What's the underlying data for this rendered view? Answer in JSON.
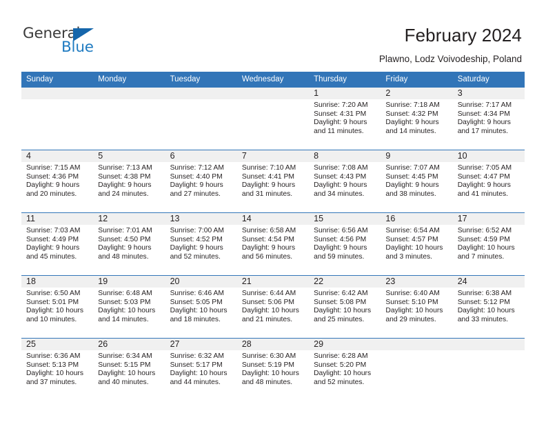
{
  "brand": {
    "name_part1": "General",
    "name_part2": "Blue",
    "accent_color": "#1f7bc1",
    "triangle_color": "#1566ab"
  },
  "header": {
    "title": "February 2024",
    "subtitle": "Plawno, Lodz Voivodeship, Poland"
  },
  "calendar": {
    "header_background": "#3275b8",
    "daynum_background": "#f0f0f0",
    "weekday_headers": [
      "Sunday",
      "Monday",
      "Tuesday",
      "Wednesday",
      "Thursday",
      "Friday",
      "Saturday"
    ],
    "weeks": [
      [
        {
          "day": "",
          "sunrise": "",
          "sunset": "",
          "daylight_line1": "",
          "daylight_line2": ""
        },
        {
          "day": "",
          "sunrise": "",
          "sunset": "",
          "daylight_line1": "",
          "daylight_line2": ""
        },
        {
          "day": "",
          "sunrise": "",
          "sunset": "",
          "daylight_line1": "",
          "daylight_line2": ""
        },
        {
          "day": "",
          "sunrise": "",
          "sunset": "",
          "daylight_line1": "",
          "daylight_line2": ""
        },
        {
          "day": "1",
          "sunrise": "Sunrise: 7:20 AM",
          "sunset": "Sunset: 4:31 PM",
          "daylight_line1": "Daylight: 9 hours",
          "daylight_line2": "and 11 minutes."
        },
        {
          "day": "2",
          "sunrise": "Sunrise: 7:18 AM",
          "sunset": "Sunset: 4:32 PM",
          "daylight_line1": "Daylight: 9 hours",
          "daylight_line2": "and 14 minutes."
        },
        {
          "day": "3",
          "sunrise": "Sunrise: 7:17 AM",
          "sunset": "Sunset: 4:34 PM",
          "daylight_line1": "Daylight: 9 hours",
          "daylight_line2": "and 17 minutes."
        }
      ],
      [
        {
          "day": "4",
          "sunrise": "Sunrise: 7:15 AM",
          "sunset": "Sunset: 4:36 PM",
          "daylight_line1": "Daylight: 9 hours",
          "daylight_line2": "and 20 minutes."
        },
        {
          "day": "5",
          "sunrise": "Sunrise: 7:13 AM",
          "sunset": "Sunset: 4:38 PM",
          "daylight_line1": "Daylight: 9 hours",
          "daylight_line2": "and 24 minutes."
        },
        {
          "day": "6",
          "sunrise": "Sunrise: 7:12 AM",
          "sunset": "Sunset: 4:40 PM",
          "daylight_line1": "Daylight: 9 hours",
          "daylight_line2": "and 27 minutes."
        },
        {
          "day": "7",
          "sunrise": "Sunrise: 7:10 AM",
          "sunset": "Sunset: 4:41 PM",
          "daylight_line1": "Daylight: 9 hours",
          "daylight_line2": "and 31 minutes."
        },
        {
          "day": "8",
          "sunrise": "Sunrise: 7:08 AM",
          "sunset": "Sunset: 4:43 PM",
          "daylight_line1": "Daylight: 9 hours",
          "daylight_line2": "and 34 minutes."
        },
        {
          "day": "9",
          "sunrise": "Sunrise: 7:07 AM",
          "sunset": "Sunset: 4:45 PM",
          "daylight_line1": "Daylight: 9 hours",
          "daylight_line2": "and 38 minutes."
        },
        {
          "day": "10",
          "sunrise": "Sunrise: 7:05 AM",
          "sunset": "Sunset: 4:47 PM",
          "daylight_line1": "Daylight: 9 hours",
          "daylight_line2": "and 41 minutes."
        }
      ],
      [
        {
          "day": "11",
          "sunrise": "Sunrise: 7:03 AM",
          "sunset": "Sunset: 4:49 PM",
          "daylight_line1": "Daylight: 9 hours",
          "daylight_line2": "and 45 minutes."
        },
        {
          "day": "12",
          "sunrise": "Sunrise: 7:01 AM",
          "sunset": "Sunset: 4:50 PM",
          "daylight_line1": "Daylight: 9 hours",
          "daylight_line2": "and 48 minutes."
        },
        {
          "day": "13",
          "sunrise": "Sunrise: 7:00 AM",
          "sunset": "Sunset: 4:52 PM",
          "daylight_line1": "Daylight: 9 hours",
          "daylight_line2": "and 52 minutes."
        },
        {
          "day": "14",
          "sunrise": "Sunrise: 6:58 AM",
          "sunset": "Sunset: 4:54 PM",
          "daylight_line1": "Daylight: 9 hours",
          "daylight_line2": "and 56 minutes."
        },
        {
          "day": "15",
          "sunrise": "Sunrise: 6:56 AM",
          "sunset": "Sunset: 4:56 PM",
          "daylight_line1": "Daylight: 9 hours",
          "daylight_line2": "and 59 minutes."
        },
        {
          "day": "16",
          "sunrise": "Sunrise: 6:54 AM",
          "sunset": "Sunset: 4:57 PM",
          "daylight_line1": "Daylight: 10 hours",
          "daylight_line2": "and 3 minutes."
        },
        {
          "day": "17",
          "sunrise": "Sunrise: 6:52 AM",
          "sunset": "Sunset: 4:59 PM",
          "daylight_line1": "Daylight: 10 hours",
          "daylight_line2": "and 7 minutes."
        }
      ],
      [
        {
          "day": "18",
          "sunrise": "Sunrise: 6:50 AM",
          "sunset": "Sunset: 5:01 PM",
          "daylight_line1": "Daylight: 10 hours",
          "daylight_line2": "and 10 minutes."
        },
        {
          "day": "19",
          "sunrise": "Sunrise: 6:48 AM",
          "sunset": "Sunset: 5:03 PM",
          "daylight_line1": "Daylight: 10 hours",
          "daylight_line2": "and 14 minutes."
        },
        {
          "day": "20",
          "sunrise": "Sunrise: 6:46 AM",
          "sunset": "Sunset: 5:05 PM",
          "daylight_line1": "Daylight: 10 hours",
          "daylight_line2": "and 18 minutes."
        },
        {
          "day": "21",
          "sunrise": "Sunrise: 6:44 AM",
          "sunset": "Sunset: 5:06 PM",
          "daylight_line1": "Daylight: 10 hours",
          "daylight_line2": "and 21 minutes."
        },
        {
          "day": "22",
          "sunrise": "Sunrise: 6:42 AM",
          "sunset": "Sunset: 5:08 PM",
          "daylight_line1": "Daylight: 10 hours",
          "daylight_line2": "and 25 minutes."
        },
        {
          "day": "23",
          "sunrise": "Sunrise: 6:40 AM",
          "sunset": "Sunset: 5:10 PM",
          "daylight_line1": "Daylight: 10 hours",
          "daylight_line2": "and 29 minutes."
        },
        {
          "day": "24",
          "sunrise": "Sunrise: 6:38 AM",
          "sunset": "Sunset: 5:12 PM",
          "daylight_line1": "Daylight: 10 hours",
          "daylight_line2": "and 33 minutes."
        }
      ],
      [
        {
          "day": "25",
          "sunrise": "Sunrise: 6:36 AM",
          "sunset": "Sunset: 5:13 PM",
          "daylight_line1": "Daylight: 10 hours",
          "daylight_line2": "and 37 minutes."
        },
        {
          "day": "26",
          "sunrise": "Sunrise: 6:34 AM",
          "sunset": "Sunset: 5:15 PM",
          "daylight_line1": "Daylight: 10 hours",
          "daylight_line2": "and 40 minutes."
        },
        {
          "day": "27",
          "sunrise": "Sunrise: 6:32 AM",
          "sunset": "Sunset: 5:17 PM",
          "daylight_line1": "Daylight: 10 hours",
          "daylight_line2": "and 44 minutes."
        },
        {
          "day": "28",
          "sunrise": "Sunrise: 6:30 AM",
          "sunset": "Sunset: 5:19 PM",
          "daylight_line1": "Daylight: 10 hours",
          "daylight_line2": "and 48 minutes."
        },
        {
          "day": "29",
          "sunrise": "Sunrise: 6:28 AM",
          "sunset": "Sunset: 5:20 PM",
          "daylight_line1": "Daylight: 10 hours",
          "daylight_line2": "and 52 minutes."
        },
        {
          "day": "",
          "sunrise": "",
          "sunset": "",
          "daylight_line1": "",
          "daylight_line2": ""
        },
        {
          "day": "",
          "sunrise": "",
          "sunset": "",
          "daylight_line1": "",
          "daylight_line2": ""
        }
      ]
    ]
  }
}
